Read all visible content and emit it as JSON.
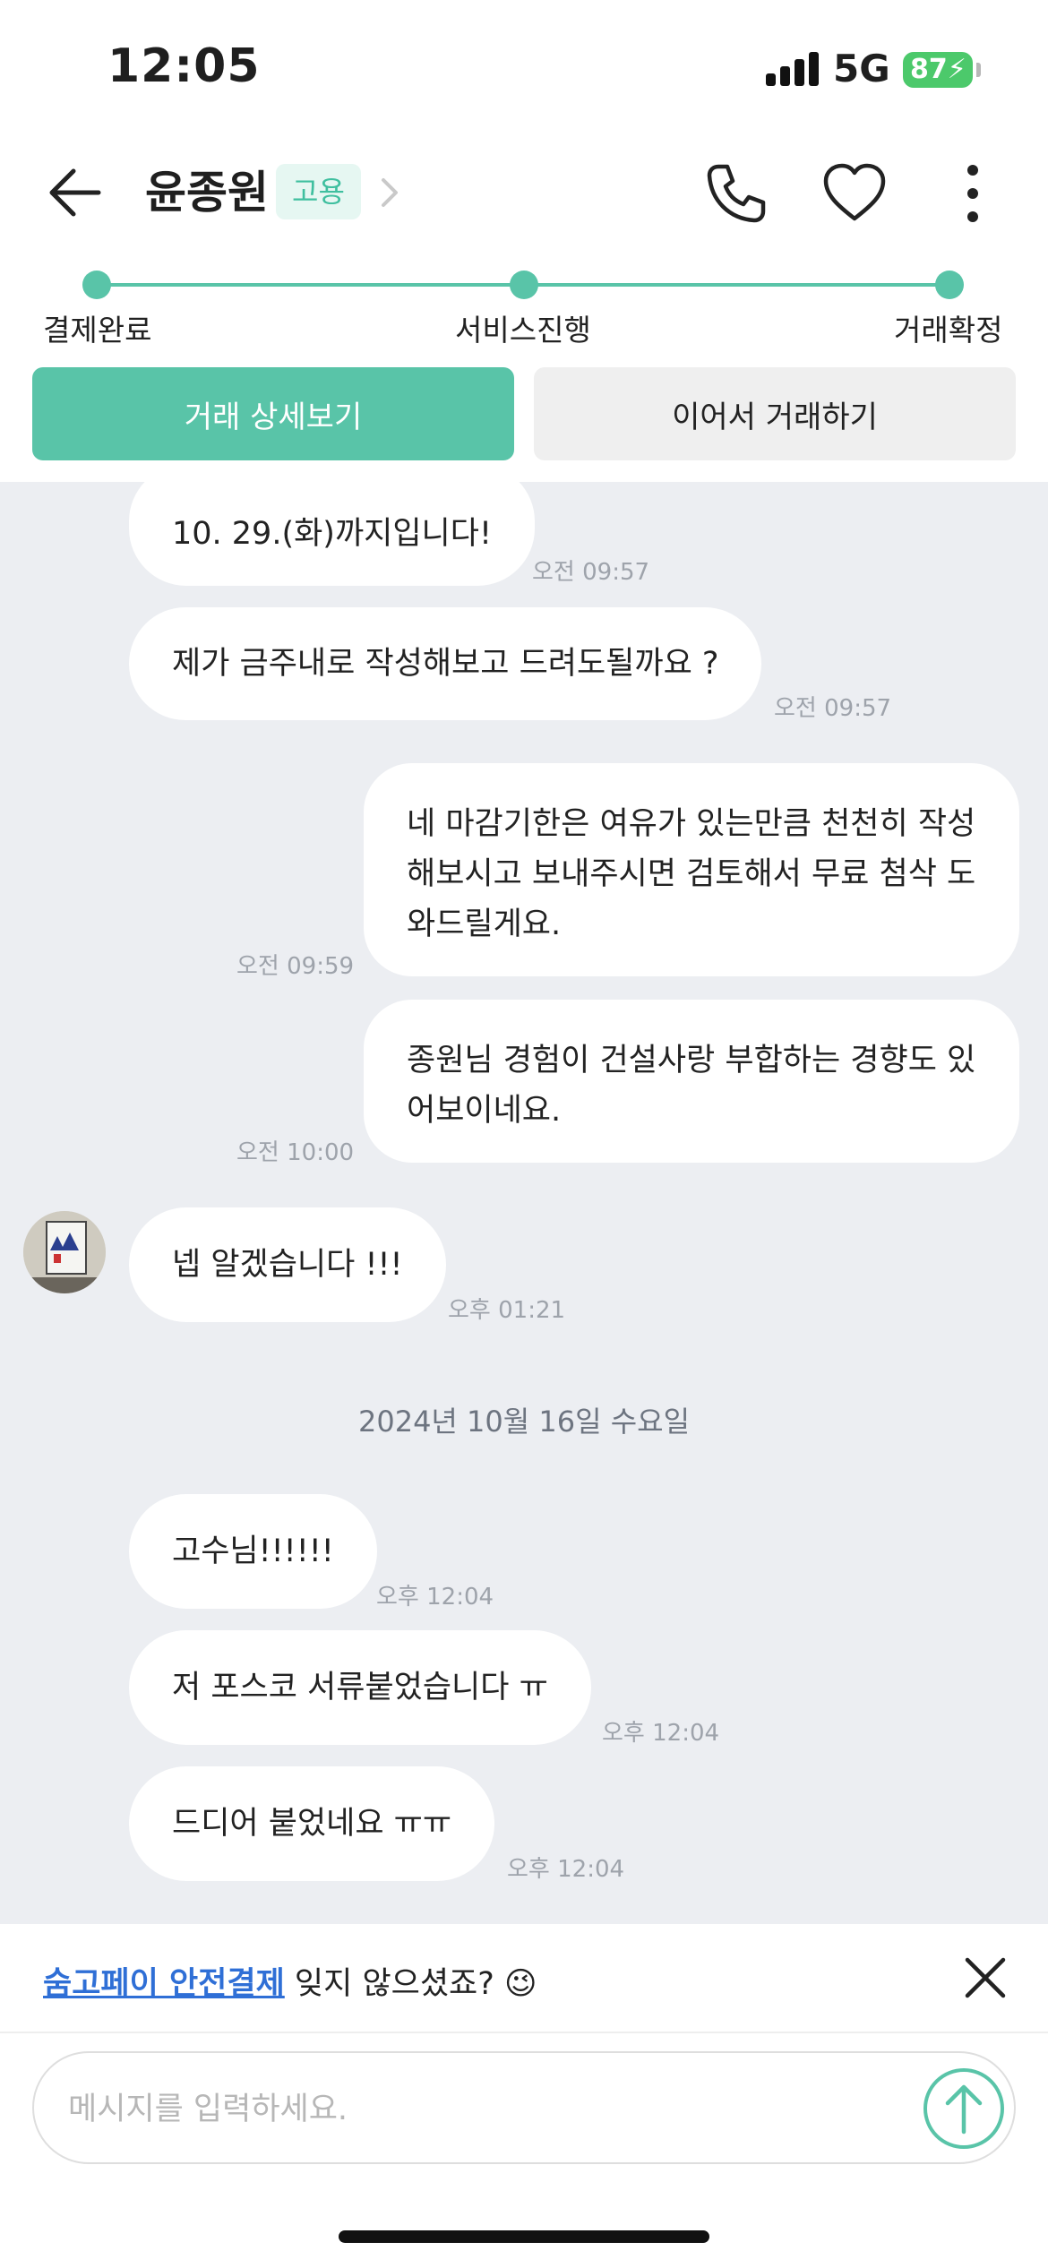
{
  "status_bar": {
    "time": "12:05",
    "network": "5G",
    "battery": "87"
  },
  "header": {
    "name": "윤종원",
    "badge": "고용"
  },
  "progress": {
    "steps": [
      "결제완료",
      "서비스진행",
      "거래확정"
    ]
  },
  "actions": {
    "detail": "거래 상세보기",
    "continue": "이어서 거래하기"
  },
  "messages": [
    {
      "side": "left",
      "text": "10. 29.(화)까지입니다!",
      "time": "오전 09:57"
    },
    {
      "side": "left",
      "text": "제가 금주내로 작성해보고 드려도될까요 ?",
      "time": "오전 09:57"
    },
    {
      "side": "right",
      "lines": [
        "네 마감기한은 여유가 있는만큼 천천히 작성",
        "해보시고 보내주시면 검토해서 무료 첨삭 도",
        "와드릴게요."
      ],
      "time": "오전 09:59"
    },
    {
      "side": "right",
      "lines": [
        "종원님 경험이 건설사랑 부합하는 경향도 있",
        "어보이네요."
      ],
      "time": "오전 10:00"
    },
    {
      "side": "left",
      "text": "넵 알겠습니다 !!!",
      "time": "오후 01:21"
    },
    {
      "date": "2024년 10월 16일 수요일"
    },
    {
      "side": "left",
      "text": "고수님!!!!!!",
      "time": "오후 12:04"
    },
    {
      "side": "left",
      "text": "저 포스코 서류붙었습니다 ㅠ",
      "time": "오후 12:04"
    },
    {
      "side": "left",
      "text": "드디어 붙었네요 ㅠㅠ",
      "time": "오후 12:04"
    }
  ],
  "banner": {
    "link": "숨고페이 안전결제",
    "text": " 잊지 않으셨죠? 😉"
  },
  "input": {
    "placeholder": "메시지를 입력하세요."
  },
  "colors": {
    "accent": "#59c4a8",
    "chat_bg": "#eceef2",
    "link": "#2f6fd6"
  }
}
